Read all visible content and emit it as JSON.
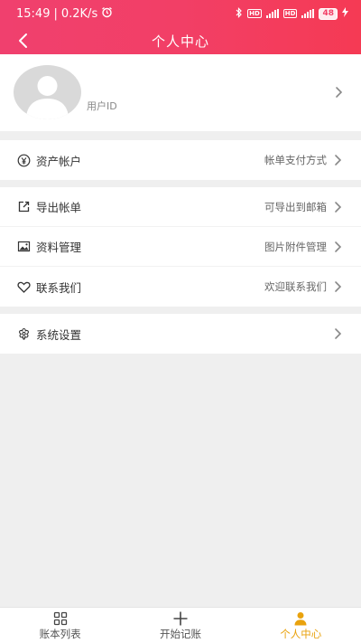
{
  "status_bar": {
    "time": "15:49",
    "network_speed": "0.2K/s",
    "battery": "48"
  },
  "nav": {
    "title": "个人中心"
  },
  "profile": {
    "user_id_label": "用户ID"
  },
  "groups": [
    {
      "items": [
        {
          "icon": "yuan-icon",
          "label": "资产帐户",
          "value": "帐单支付方式"
        }
      ]
    },
    {
      "items": [
        {
          "icon": "export-icon",
          "label": "导出帐单",
          "value": "可导出到邮箱"
        },
        {
          "icon": "image-icon",
          "label": "资料管理",
          "value": "图片附件管理"
        },
        {
          "icon": "heart-icon",
          "label": "联系我们",
          "value": "欢迎联系我们"
        }
      ]
    },
    {
      "items": [
        {
          "icon": "flower-settings-icon",
          "label": "系统设置",
          "value": ""
        }
      ]
    }
  ],
  "tabbar": {
    "tabs": [
      {
        "label": "账本列表",
        "icon": "grid-icon",
        "active": false
      },
      {
        "label": "开始记账",
        "icon": "plus-icon",
        "active": false
      },
      {
        "label": "个人中心",
        "icon": "user-icon",
        "active": true
      }
    ]
  },
  "colors": {
    "header_start": "#f0406e",
    "header_end": "#f53a54",
    "background": "#efefef",
    "active_tab": "#e9a20d"
  }
}
